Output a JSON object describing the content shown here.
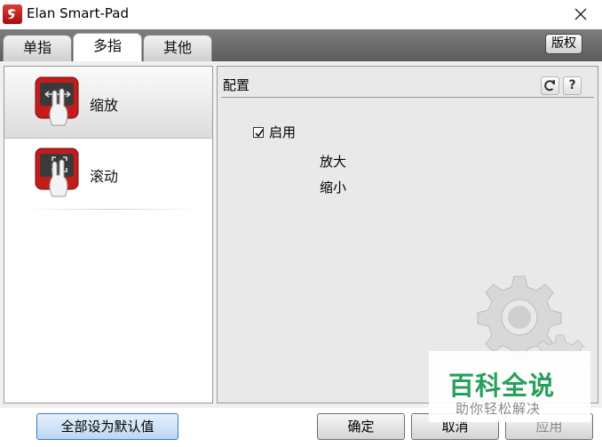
{
  "window": {
    "title": "Elan Smart-Pad"
  },
  "tabs": [
    {
      "label": "单指",
      "active": false
    },
    {
      "label": "多指",
      "active": true
    },
    {
      "label": "其他",
      "active": false
    }
  ],
  "version_button": "版权",
  "gestures": [
    {
      "label": "缩放",
      "selected": true
    },
    {
      "label": "滚动",
      "selected": false
    }
  ],
  "config": {
    "header": "配置",
    "enable_label": "启用",
    "enabled": true,
    "options": [
      "放大",
      "缩小"
    ]
  },
  "buttons": {
    "reset_defaults": "全部设为默认值",
    "ok": "确定",
    "cancel": "取消",
    "apply": "应用"
  },
  "watermark": {
    "title": "百科全说",
    "subtitle": "助你轻松解决"
  },
  "colors": {
    "accent_red": "#c41c1c",
    "tabstrip": "#6a6a6a",
    "watermark_green": "#26a05a"
  }
}
